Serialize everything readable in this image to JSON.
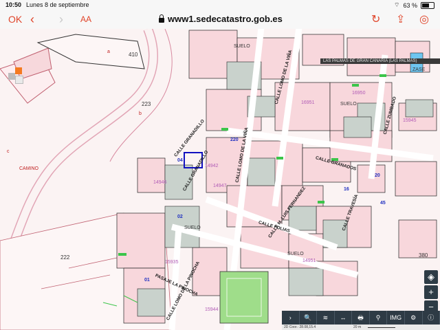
{
  "status": {
    "time": "10:50",
    "date": "Lunes 8 de septiembre",
    "battery": "63 %"
  },
  "browser": {
    "ok_label": "OK",
    "back": "‹",
    "forward": "›",
    "text_size": "AA",
    "url": "www1.sedecatastro.gob.es",
    "reload": "↻",
    "share": "⇪",
    "compass": "◎"
  },
  "map": {
    "location": "LAS PALMAS DE GRAN CANARIA (LAS PALMAS)",
    "labels": {
      "p410": "410",
      "p223": "223",
      "p222": "222",
      "p380": "380",
      "camino": "CAMINO",
      "b": "b",
      "a": "a",
      "c": "c",
      "n14946": "14946",
      "n14942": "14942",
      "n15935": "15935",
      "n15944": "15944",
      "n16950": "16950",
      "n16951": "16951",
      "n14951": "14951",
      "n15945": "15945",
      "n14947": "14947",
      "suelo": "SUELO",
      "zase": "ZASE",
      "num220": "220",
      "num04": "04",
      "num02": "02",
      "num01": "01",
      "num45": "45",
      "num20": "20",
      "num16": "16"
    },
    "streets": {
      "granadillo": "CALLE GRANADILLO",
      "lomo_vina": "CALLE LOMO DE LA VIÑA",
      "granadillo2": "CALLE GRANADILLO",
      "lomo_la_nina": "CALLE LOMO DE LA VIÑA",
      "granados": "CALLE GRANADOS",
      "folias": "CALLE FOLIAS",
      "ferezas": "CALLE M. LUIS FERNANDEZ",
      "traviesa": "CALLE TRAVESÍA",
      "zumbado": "CALLE ZUMBADO",
      "pasaje": "PASAJE LA PINOCHA",
      "lomo_pinocha": "CALLE LOMO DE LA PINOCHA",
      "lomo_vina3": "CALLE LOMO DE LA VIÑA"
    },
    "scale": "20 m",
    "coords": "2D Coor.: 28.08,15.4",
    "zoom_in": "+",
    "zoom_out": "−",
    "locate": "◈"
  },
  "bottom_tools": [
    "›",
    "🔍",
    "≋",
    "↔",
    "🖶",
    "⚲",
    "IMG",
    "⚙",
    "ⓘ"
  ]
}
